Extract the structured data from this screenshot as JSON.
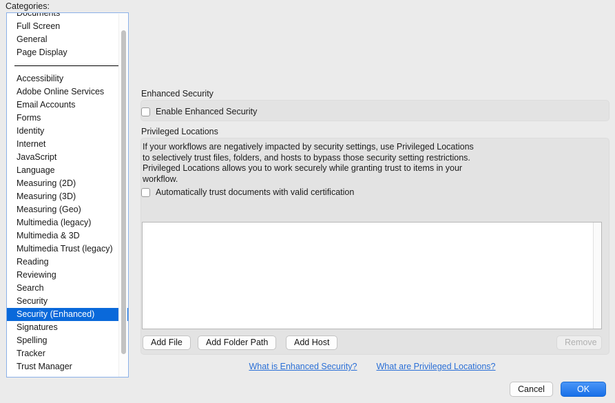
{
  "categories": {
    "label": "Categories:",
    "items": [
      {
        "label": "Documents",
        "selected": false,
        "clipped": true
      },
      {
        "label": "Full Screen",
        "selected": false
      },
      {
        "label": "General",
        "selected": false
      },
      {
        "label": "Page Display",
        "selected": false
      },
      {
        "separator": true
      },
      {
        "label": "Accessibility",
        "selected": false
      },
      {
        "label": "Adobe Online Services",
        "selected": false
      },
      {
        "label": "Email Accounts",
        "selected": false
      },
      {
        "label": "Forms",
        "selected": false
      },
      {
        "label": "Identity",
        "selected": false
      },
      {
        "label": "Internet",
        "selected": false
      },
      {
        "label": "JavaScript",
        "selected": false
      },
      {
        "label": "Language",
        "selected": false
      },
      {
        "label": "Measuring (2D)",
        "selected": false
      },
      {
        "label": "Measuring (3D)",
        "selected": false
      },
      {
        "label": "Measuring (Geo)",
        "selected": false
      },
      {
        "label": "Multimedia (legacy)",
        "selected": false
      },
      {
        "label": "Multimedia & 3D",
        "selected": false
      },
      {
        "label": "Multimedia Trust (legacy)",
        "selected": false
      },
      {
        "label": "Reading",
        "selected": false
      },
      {
        "label": "Reviewing",
        "selected": false
      },
      {
        "label": "Search",
        "selected": false
      },
      {
        "label": "Security",
        "selected": false
      },
      {
        "label": "Security (Enhanced)",
        "selected": true
      },
      {
        "label": "Signatures",
        "selected": false
      },
      {
        "label": "Spelling",
        "selected": false
      },
      {
        "label": "Tracker",
        "selected": false
      },
      {
        "label": "Trust Manager",
        "selected": false
      }
    ]
  },
  "enhanced_security": {
    "title": "Enhanced Security",
    "enable_label": "Enable Enhanced Security",
    "enable_checked": false
  },
  "privileged_locations": {
    "title": "Privileged Locations",
    "description": "If your workflows are negatively impacted by security settings, use Privileged Locations to selectively trust files, folders, and hosts to bypass those security setting restrictions. Privileged Locations allows you to work securely while granting trust to items in your workflow.",
    "auto_trust_label": "Automatically trust documents with valid certification",
    "auto_trust_checked": false,
    "list_items": [],
    "buttons": {
      "add_file": "Add File",
      "add_folder_path": "Add Folder Path",
      "add_host": "Add Host",
      "remove": "Remove",
      "remove_disabled": true
    }
  },
  "links": [
    "What is Enhanced Security?",
    "What are Privileged Locations?"
  ],
  "footer": {
    "cancel": "Cancel",
    "ok": "OK"
  },
  "colors": {
    "selection_blue": "#0a69da",
    "link_blue": "#2a6fd6",
    "default_button_blue": "#176fe8",
    "window_background": "#ebebeb",
    "group_background": "#e3e3e3"
  }
}
